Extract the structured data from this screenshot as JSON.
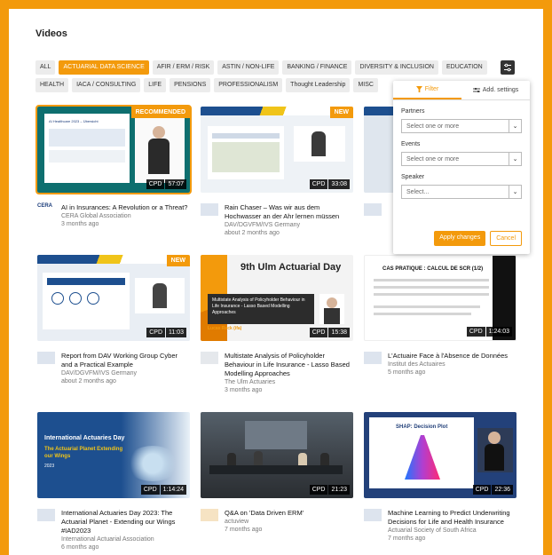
{
  "page": {
    "title": "Videos"
  },
  "chips": [
    {
      "label": "ALL",
      "active": false
    },
    {
      "label": "ACTUARIAL DATA SCIENCE",
      "active": true
    },
    {
      "label": "AFIR / ERM / RISK",
      "active": false
    },
    {
      "label": "ASTIN / NON-LIFE",
      "active": false
    },
    {
      "label": "BANKING / FINANCE",
      "active": false
    },
    {
      "label": "DIVERSITY & INCLUSION",
      "active": false
    },
    {
      "label": "EDUCATION",
      "active": false
    },
    {
      "label": "HEALTH",
      "active": false
    },
    {
      "label": "IACA / CONSULTING",
      "active": false
    },
    {
      "label": "LIFE",
      "active": false
    },
    {
      "label": "PENSIONS",
      "active": false
    },
    {
      "label": "PROFESSIONALISM",
      "active": false
    },
    {
      "label": "Thought Leadership",
      "active": false
    },
    {
      "label": "MISC",
      "active": false
    }
  ],
  "filter_panel": {
    "tab_filter": "Filter",
    "tab_settings": "Add. settings",
    "partners_label": "Partners",
    "partners_placeholder": "Select one or more",
    "events_label": "Events",
    "events_placeholder": "Select one or more",
    "speaker_label": "Speaker",
    "speaker_placeholder": "Select...",
    "apply": "Apply changes",
    "cancel": "Cancel"
  },
  "videos": [
    {
      "title": "AI in Insurances: A Revolution or a Threat?",
      "channel": "CERA Global Association",
      "age": "3 months ago",
      "cpd": "CPD",
      "duration": "57:07",
      "tag": "RECOMMENDED",
      "thumb": "#0e6f6f"
    },
    {
      "title": "Rain Chaser – Was wir aus dem Hochwasser an der Ahr lernen müssen",
      "channel": "DAV/DGVFM/IVS Germany",
      "age": "about 2 months ago",
      "cpd": "CPD",
      "duration": "33:08",
      "tag": "NEW",
      "thumb": "#eef2f6"
    },
    {
      "title": "",
      "channel": "",
      "age": "",
      "cpd": "",
      "duration": "",
      "tag": "",
      "thumb": "#dfe6ee"
    },
    {
      "title": "Report from DAV Working Group Cyber and a Practical Example",
      "channel": "DAV/DGVFM/IVS Germany",
      "age": "about 2 months ago",
      "cpd": "CPD",
      "duration": "11:03",
      "tag": "NEW",
      "thumb": "#e9eef4"
    },
    {
      "title": "Multistate Analysis of Policyholder Behaviour in Life Insurance - Lasso Based Modelling Approaches",
      "channel": "The Ulm Actuaries",
      "age": "3 months ago",
      "cpd": "CPD",
      "duration": "15:38",
      "tag": "",
      "thumb": "#f3f3f3"
    },
    {
      "title": "L'Actuaire Face à l'Absence de Données",
      "channel": "Institut des Actuaires",
      "age": "5 months ago",
      "cpd": "CPD",
      "duration": "1:24:03",
      "tag": "",
      "thumb": "#ffffff"
    },
    {
      "title": "International Actuaries Day 2023: The Actuarial Planet - Extending our Wings #IAD2023",
      "channel": "International Actuarial Association",
      "age": "6 months ago",
      "cpd": "CPD",
      "duration": "1:14:24",
      "tag": "",
      "thumb": "#1d4f8f"
    },
    {
      "title": "Q&A on 'Data Driven ERM'",
      "channel": "actuview",
      "age": "7 months ago",
      "cpd": "CPD",
      "duration": "21:23",
      "tag": "",
      "thumb": "#3a3f45"
    },
    {
      "title": "Machine Learning to Predict Underwriting Decisions for Life and Health Insurance",
      "channel": "Actuarial Society of South Africa",
      "age": "7 months ago",
      "cpd": "CPD",
      "duration": "22:36",
      "tag": "",
      "thumb": "#23417a"
    }
  ],
  "thumb_text": {
    "v1_slide": "AI Healthcare 2023 – Übersicht",
    "v5_banner": "9th Ulm Actuarial Day",
    "v5_box": "Multistate Analysis of Policyholder Behaviour in Life Insurance - Lasso Based Modelling Approaches",
    "v5_speaker": "Lucas Reck (ifa)",
    "v6_slide": "CAS PRATIQUE : CALCUL DE SCR (1/2)",
    "v7_head": "International Actuaries Day",
    "v7_sub": "The Actuarial Planet Extending our Wings",
    "v7_year": "2023",
    "v9_slide": "SHAP: Decision Plot"
  }
}
